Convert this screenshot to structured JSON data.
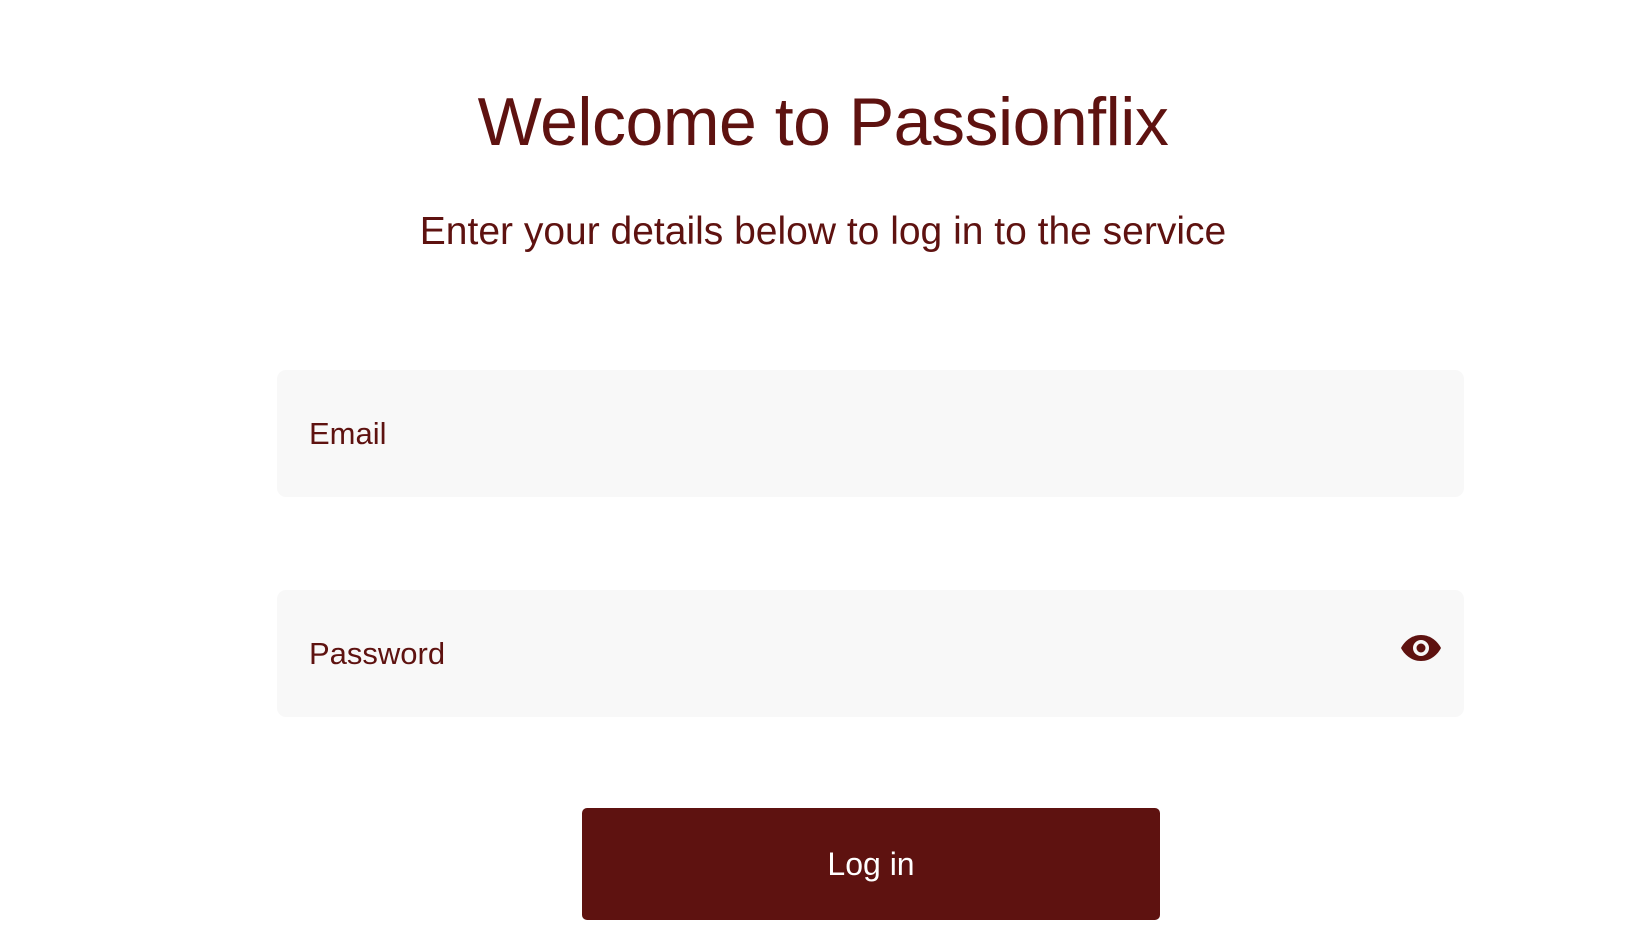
{
  "header": {
    "title": "Welcome to Passionflix",
    "subtitle": "Enter your details below to log in to the service"
  },
  "form": {
    "email_placeholder": "Email",
    "password_placeholder": "Password",
    "password_toggle_icon": "eye-icon",
    "submit_label": "Log in"
  },
  "colors": {
    "brand": "#5e1210",
    "field_bg": "#f8f8f8",
    "page_bg": "#ffffff"
  }
}
